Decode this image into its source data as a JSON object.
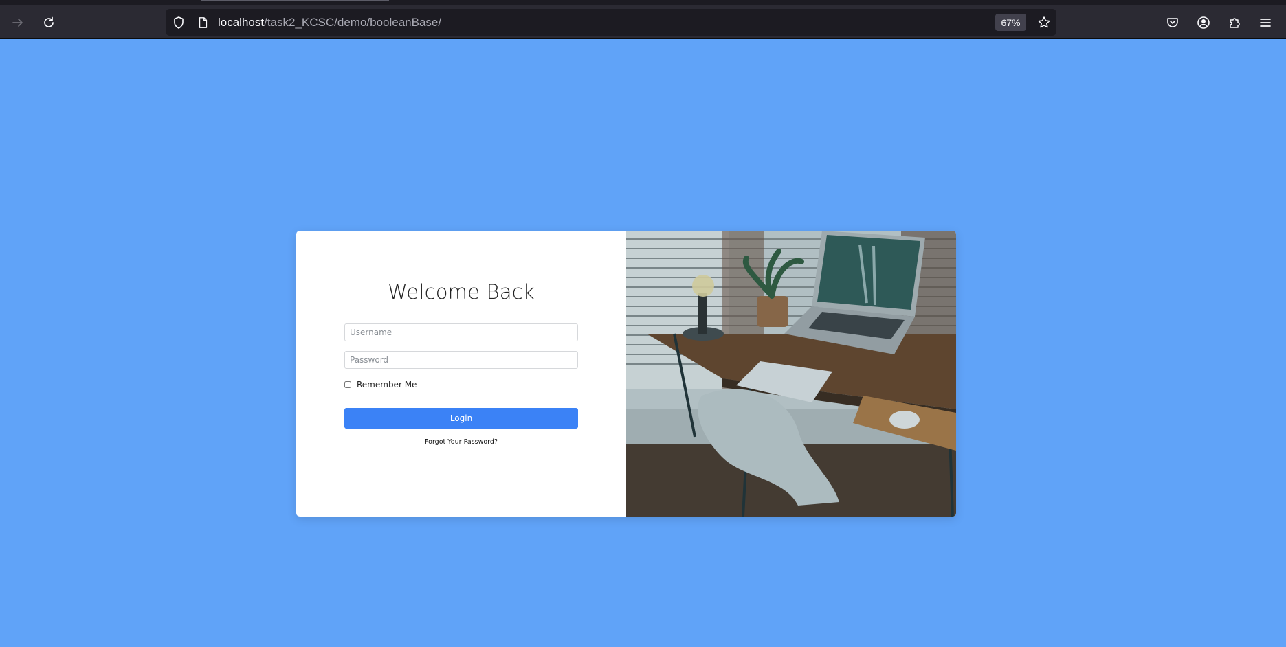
{
  "browser": {
    "url_host": "localhost",
    "url_path": "/task2_KCSC/demo/booleanBase/",
    "zoom": "67%",
    "icons": {
      "forward": "arrow-right-icon",
      "reload": "reload-icon",
      "tracking": "shield-icon",
      "page": "page-icon",
      "bookmark": "star-icon",
      "pocket": "pocket-icon",
      "account": "account-icon",
      "extensions": "puzzle-icon",
      "menu": "hamburger-icon"
    }
  },
  "login": {
    "title": "Welcome Back",
    "username_placeholder": "Username",
    "password_placeholder": "Password",
    "remember_label": "Remember Me",
    "remember_checked": false,
    "login_label": "Login",
    "forgot_label": "Forgot Your Password?"
  },
  "colors": {
    "page_background": "#60a3f8",
    "login_button": "#3b82f6",
    "toolbar": "#2b2a33"
  }
}
